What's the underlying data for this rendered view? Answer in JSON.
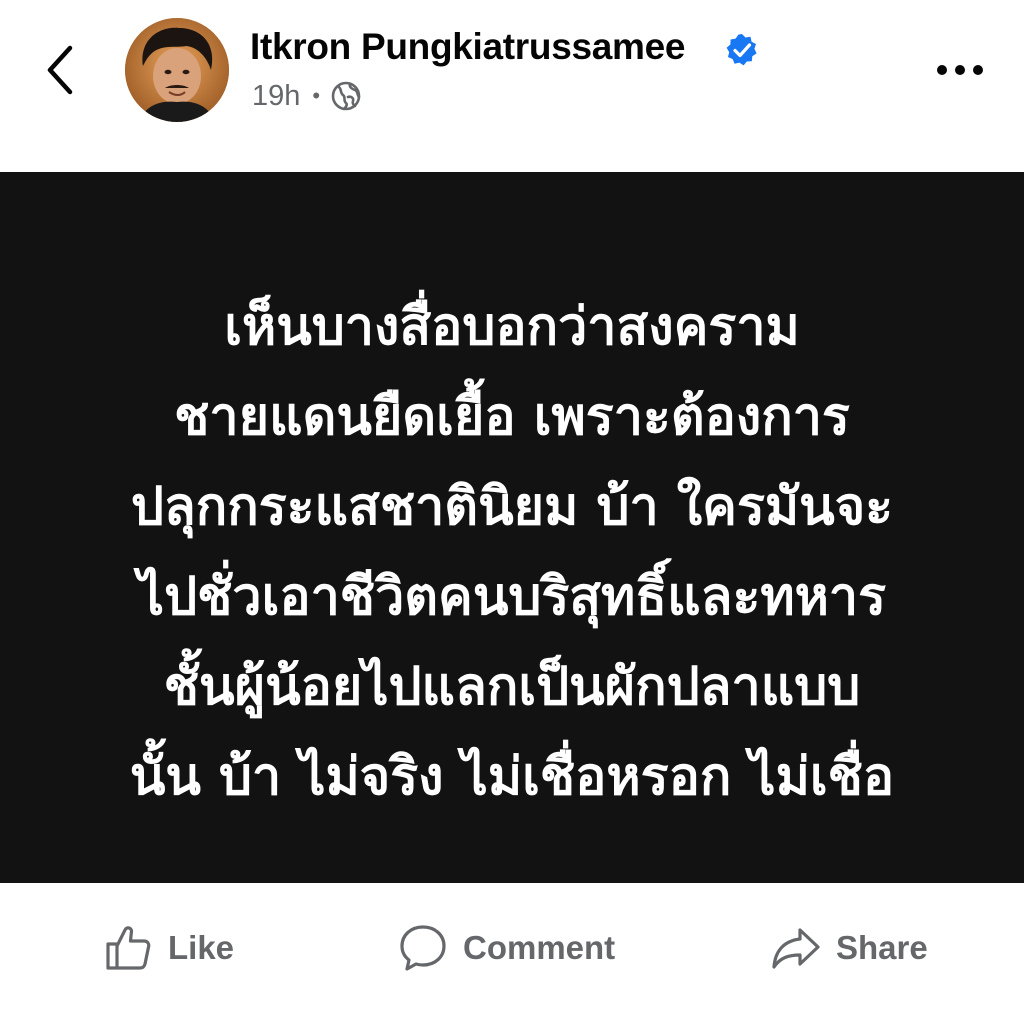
{
  "header": {
    "author_name": "Itkron Pungkiatrussamee",
    "timestamp": "19h",
    "separator": "•",
    "verified": true
  },
  "post": {
    "lines": [
      "เห็นบางสื่อบอกว่าสงคราม",
      "ชายแดนยืดเยื้อ เพราะต้องการ",
      "ปลุกกระแสชาตินิยม บ้า ใครมันจะ",
      "ไปชั่วเอาชีวิตคนบริสุทธิ์และทหาร",
      "ชั้นผู้น้อยไปแลกเป็นผักปลาแบบ",
      "นั้น บ้า ไม่จริง ไม่เชื่อหรอก ไม่เชื่อ"
    ]
  },
  "actions": {
    "like_label": "Like",
    "comment_label": "Comment",
    "share_label": "Share"
  },
  "colors": {
    "card_background": "#121212",
    "verified_blue": "#1877f2",
    "meta_gray": "#65676b",
    "name_black": "#050505"
  }
}
